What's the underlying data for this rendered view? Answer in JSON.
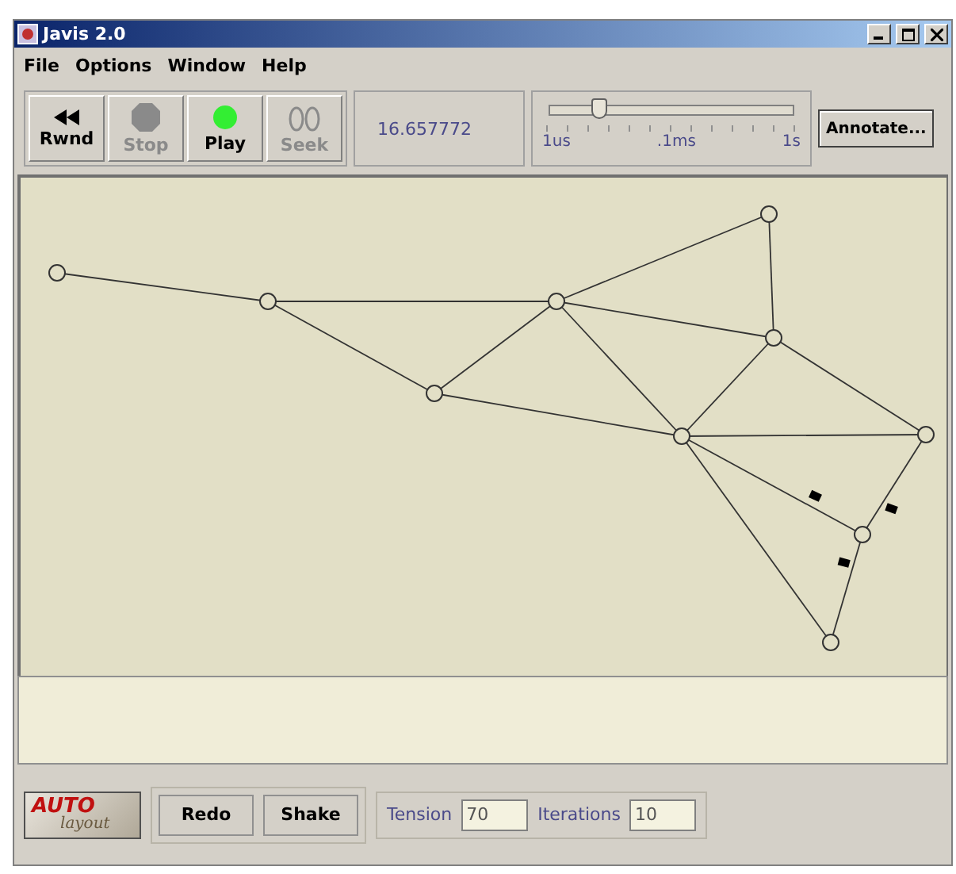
{
  "window": {
    "title": "Javis 2.0"
  },
  "menu": [
    "File",
    "Options",
    "Window",
    "Help"
  ],
  "controls": [
    {
      "kind": "rewind",
      "label": "Rwnd",
      "disabled": false
    },
    {
      "kind": "stop",
      "label": "Stop",
      "disabled": true
    },
    {
      "kind": "play",
      "label": "Play",
      "disabled": false
    },
    {
      "kind": "seek",
      "label": "Seek",
      "disabled": true
    }
  ],
  "time": "16.657772",
  "speed_slider": {
    "level": 0.2,
    "labels": [
      "1us",
      ".1ms",
      "1s"
    ]
  },
  "annotate_button": "Annotate...",
  "logo": {
    "word_1": "AUTO",
    "word_2": "layout"
  },
  "layout_buttons": [
    "Redo",
    "Shake"
  ],
  "fields": [
    {
      "label": "Tension",
      "value": "70"
    },
    {
      "label": "Iterations",
      "value": "10"
    }
  ]
}
